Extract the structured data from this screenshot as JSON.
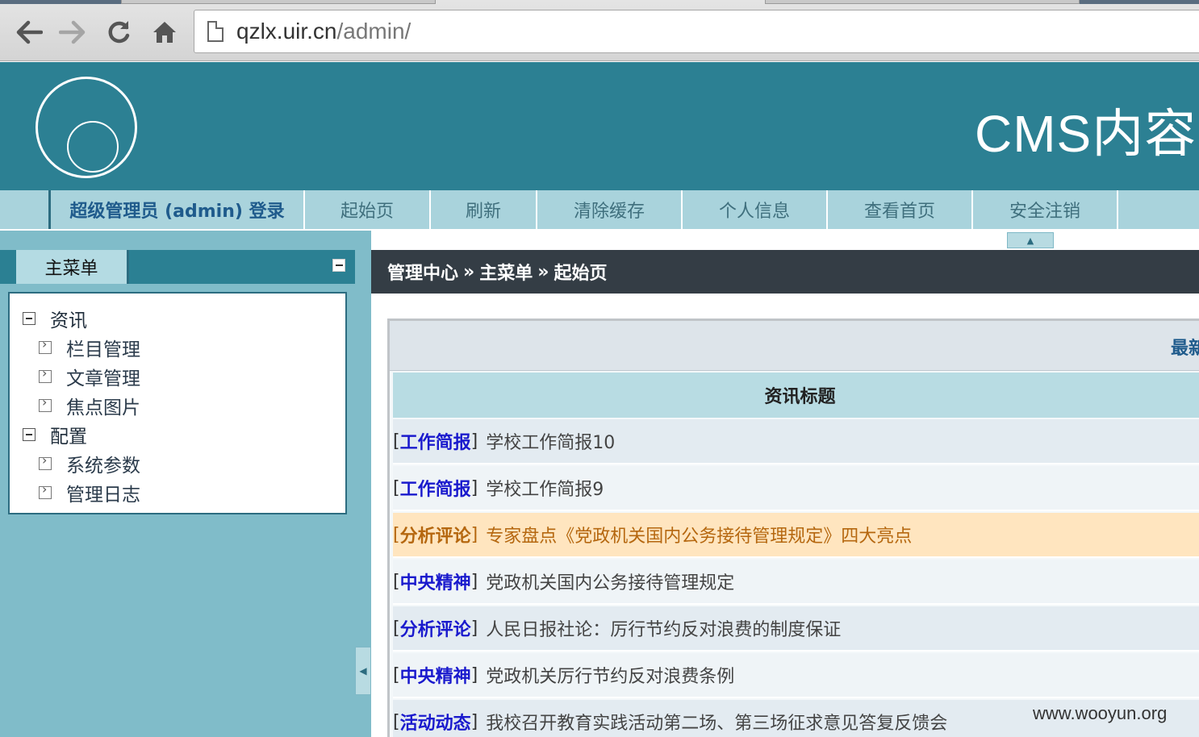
{
  "browser": {
    "url_host": "qzlx.uir.cn",
    "url_path": "/admin/"
  },
  "banner": {
    "title": "CMS内容"
  },
  "toolbar": {
    "user_label": "超级管理员 (admin) 登录",
    "items": [
      "起始页",
      "刷新",
      "清除缓存",
      "个人信息",
      "查看首页",
      "安全注销"
    ]
  },
  "sidebar": {
    "title": "主菜单",
    "groups": [
      {
        "label": "资讯",
        "items": [
          "栏目管理",
          "文章管理",
          "焦点图片"
        ]
      },
      {
        "label": "配置",
        "items": [
          "系统参数",
          "管理日志"
        ]
      }
    ]
  },
  "breadcrumb": [
    "管理中心",
    "主菜单",
    "起始页"
  ],
  "breadcrumb_sep": "»",
  "panel": {
    "head_text": "最新",
    "column_header": "资讯标题",
    "rows": [
      {
        "category": "工作简报",
        "title": "学校工作简报10"
      },
      {
        "category": "工作简报",
        "title": "学校工作简报9"
      },
      {
        "category": "分析评论",
        "title": "专家盘点《党政机关国内公务接待管理规定》四大亮点"
      },
      {
        "category": "中央精神",
        "title": "党政机关国内公务接待管理规定"
      },
      {
        "category": "分析评论",
        "title": "人民日报社论：厉行节约反对浪费的制度保证"
      },
      {
        "category": "中央精神",
        "title": "党政机关厉行节约反对浪费条例"
      },
      {
        "category": "活动动态",
        "title": "我校召开教育实践活动第二场、第三场征求意见答复反馈会"
      }
    ]
  },
  "watermark": "www.wooyun.org",
  "colors": {
    "banner": "#2c8093",
    "toolbar": "#a9d3dc",
    "sidebar": "#80bcc9",
    "highlight_row": "#ffe5bf",
    "category_link": "#1a1acd"
  }
}
